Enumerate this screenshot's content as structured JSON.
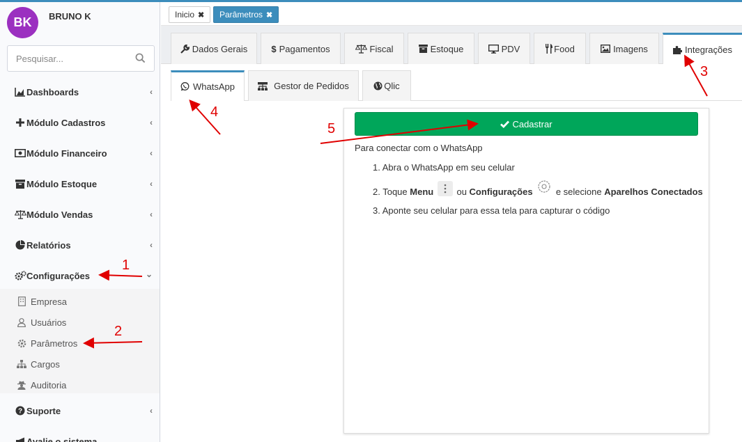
{
  "colors": {
    "accent": "#3c8dbc",
    "success": "#00a65a",
    "avatar_bg": "#9b30c0",
    "annotation": "#e00000"
  },
  "user": {
    "initials": "BK",
    "name": "BRUNO K"
  },
  "search": {
    "placeholder": "Pesquisar...",
    "icon": "search-icon"
  },
  "sidebar": {
    "items": [
      {
        "label": "Dashboards",
        "icon": "area-chart-icon"
      },
      {
        "label": "Módulo Cadastros",
        "icon": "plus-icon"
      },
      {
        "label": "Módulo Financeiro",
        "icon": "money-icon"
      },
      {
        "label": "Módulo Estoque",
        "icon": "archive-icon"
      },
      {
        "label": "Módulo Vendas",
        "icon": "balance-scale-icon"
      },
      {
        "label": "Relatórios",
        "icon": "pie-chart-icon"
      },
      {
        "label": "Configurações",
        "icon": "cogs-icon"
      },
      {
        "label": "Suporte",
        "icon": "question-circle-icon"
      },
      {
        "label": "Avalie o sistema",
        "icon": "bullhorn-icon"
      }
    ],
    "submenu": [
      {
        "label": "Empresa",
        "icon": "building-icon"
      },
      {
        "label": "Usuários",
        "icon": "user-icon"
      },
      {
        "label": "Parâmetros",
        "icon": "gear-icon"
      },
      {
        "label": "Cargos",
        "icon": "sitemap-icon"
      },
      {
        "label": "Auditoria",
        "icon": "user-secret-icon"
      }
    ]
  },
  "breadcrumbs": [
    {
      "label": "Inicio",
      "active": false
    },
    {
      "label": "Parâmetros",
      "active": true
    }
  ],
  "tabs": [
    {
      "label": "Dados Gerais",
      "icon": "wrench-icon"
    },
    {
      "label": "Pagamentos",
      "icon": "dollar-icon"
    },
    {
      "label": "Fiscal",
      "icon": "balance-scale-icon"
    },
    {
      "label": "Estoque",
      "icon": "archive-icon"
    },
    {
      "label": "PDV",
      "icon": "desktop-icon"
    },
    {
      "label": "Food",
      "icon": "cutlery-icon"
    },
    {
      "label": "Imagens",
      "icon": "image-icon"
    },
    {
      "label": "Integrações",
      "icon": "puzzle-piece-icon",
      "active": true
    }
  ],
  "subtabs": [
    {
      "label": "WhatsApp",
      "icon": "whatsapp-icon",
      "active": true
    },
    {
      "label": "Gestor de Pedidos",
      "icon": "sitemap-icon"
    },
    {
      "label": "Qlic",
      "icon": "globe-icon"
    }
  ],
  "panel": {
    "button_label": "Cadastrar",
    "intro": "Para conectar com o WhatsApp",
    "step1": "1. Abra o WhatsApp em seu celular",
    "step2_prefix": "2. Toque ",
    "step2_menu": "Menu",
    "step2_or": " ou ",
    "step2_config": "Configurações",
    "step2_select": " e selecione ",
    "step2_devices": "Aparelhos Conectados",
    "step3": "3. Aponte seu celular para essa tela para capturar o código"
  },
  "annotations": [
    "1",
    "2",
    "3",
    "4",
    "5"
  ]
}
